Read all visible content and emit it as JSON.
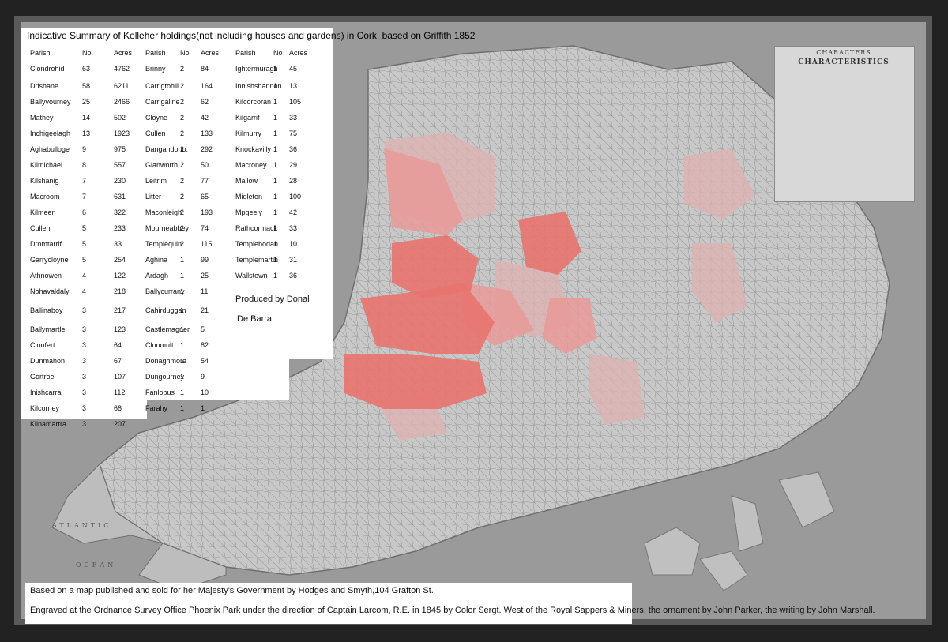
{
  "summary": {
    "title": "Indicative Summary of Kelleher holdings(not including houses and gardens) in Cork, based on Griffith 1852",
    "headers": {
      "col1": [
        "Parish",
        "No.",
        "Acres"
      ],
      "col2": [
        "Parish",
        "No",
        "Acres"
      ],
      "col3": [
        "Parish",
        "No",
        "Acres"
      ]
    },
    "col1": [
      [
        "Clondrohid",
        "63",
        "4762"
      ],
      [
        "Drishane",
        "58",
        "6211"
      ],
      [
        "Ballyvourney",
        "25",
        "2466"
      ],
      [
        "Mathey",
        "14",
        "502"
      ],
      [
        "Inchigeelagh",
        "13",
        "1923"
      ],
      [
        "Aghabulloge",
        "9",
        "975"
      ],
      [
        "Kilmichael",
        "8",
        "557"
      ],
      [
        "Kilshanig",
        "7",
        "230"
      ],
      [
        "Macroom",
        "7",
        "631"
      ],
      [
        "Kilmeen",
        "6",
        "322"
      ],
      [
        "Cullen",
        "5",
        "233"
      ],
      [
        "Dromtarrif",
        "5",
        "33"
      ],
      [
        "Garrycloyne",
        "5",
        "254"
      ],
      [
        "Athnowen",
        "4",
        "122"
      ],
      [
        "Nohavaldaly",
        "4",
        "218"
      ],
      [
        "Ballinaboy",
        "3",
        "217"
      ],
      [
        "Ballymartle",
        "3",
        "123"
      ],
      [
        "Clonfert",
        "3",
        "64"
      ],
      [
        "Dunmahon",
        "3",
        "67"
      ],
      [
        "Gortroe",
        "3",
        "107"
      ],
      [
        "Inishcarra",
        "3",
        "112"
      ],
      [
        "Kilcorney",
        "3",
        "68"
      ],
      [
        "Kilnamartra",
        "3",
        "207"
      ]
    ],
    "col2": [
      [
        "Brinny",
        "2",
        "84"
      ],
      [
        "Carrigtohill",
        "2",
        "164"
      ],
      [
        "Carrigaline",
        "2",
        "62"
      ],
      [
        "Cloyne",
        "2",
        "42"
      ],
      [
        "Cullen",
        "2",
        "133"
      ],
      [
        "Dangandono.",
        "2",
        "292"
      ],
      [
        "Glanworth",
        "2",
        "50"
      ],
      [
        "Leitrim",
        "2",
        "77"
      ],
      [
        "Litter",
        "2",
        "65"
      ],
      [
        "Maconleigh",
        "2",
        "193"
      ],
      [
        "Mourneabbey",
        "2",
        "74"
      ],
      [
        "Templequin.",
        "2",
        "115"
      ],
      [
        "Aghina",
        "1",
        "99"
      ],
      [
        "Ardagh",
        "1",
        "25"
      ],
      [
        "Ballycurrany",
        "1",
        "11"
      ],
      [
        "Cahirduggan",
        "1",
        "21"
      ],
      [
        "Castlemagner",
        "1",
        "5"
      ],
      [
        "Clonmult",
        "1",
        "82"
      ],
      [
        "Donaghmore",
        "1",
        "54"
      ],
      [
        "Dungourney",
        "1",
        "9"
      ],
      [
        "Fanlobus",
        "1",
        "10"
      ],
      [
        "Farahy",
        "1",
        "1"
      ]
    ],
    "col3": [
      [
        "Ightermuragh",
        "1",
        "45"
      ],
      [
        "Innishshannon",
        "1",
        "13"
      ],
      [
        "Kilcorcoran",
        "1",
        "105"
      ],
      [
        "Kilgarrif",
        "1",
        "33"
      ],
      [
        "Kilmurry",
        "1",
        "75"
      ],
      [
        "Knockavilly",
        "1",
        "36"
      ],
      [
        "Macroney",
        "1",
        "29"
      ],
      [
        "Mallow",
        "1",
        "28"
      ],
      [
        "Midleton",
        "1",
        "100"
      ],
      [
        "Mpgeely",
        "1",
        "42"
      ],
      [
        "Rathcormack",
        "1",
        "33"
      ],
      [
        "Templebodan",
        "1",
        "10"
      ],
      [
        "Templemartin",
        "1",
        "31"
      ],
      [
        "Wallstown",
        "1",
        "36"
      ]
    ],
    "credit_line1": "Produced by Donal",
    "credit_line2": "De Barra"
  },
  "footer": {
    "line1": "Based on a map published and sold for her Majesty's Government by Hodges and Smyth,104 Grafton St.",
    "line2": "Engraved at the Ordnance Survey Office Phoenix Park under the direction of Captain Larcom, R.E. in 1845 by Color Sergt. West of the Royal Sappers & Miners, the ornament by John Parker, the writing by John Marshall."
  },
  "legend": {
    "title": "CHARACTERS",
    "subtitle": "CHARACTERISTICS"
  },
  "map_labels": {
    "atlantic": "ATLANTIC",
    "ocean": "OCEAN"
  },
  "colors": {
    "highlight_strong": "#e8736f",
    "highlight_medium": "#e99a98",
    "highlight_light": "#dcb3b2",
    "map_land": "#c8c8c8",
    "map_paper": "#9a9a9a"
  }
}
